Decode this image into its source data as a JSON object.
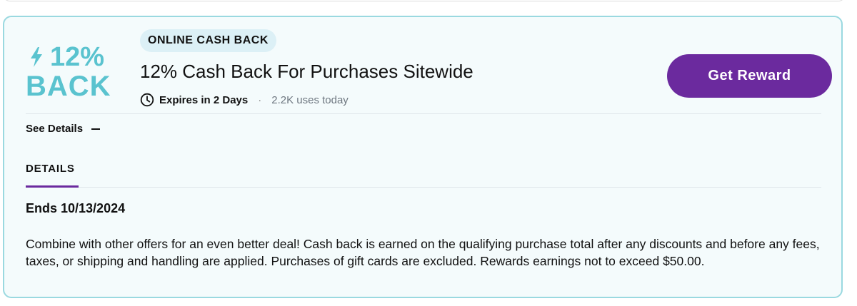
{
  "badge": {
    "line1": "12%",
    "line2": "BACK",
    "icon": "lightning-bolt-icon"
  },
  "offer": {
    "type_tag": "ONLINE CASH BACK",
    "title": "12% Cash Back For Purchases Sitewide",
    "expires": "Expires in 2 Days",
    "separator": "·",
    "uses": "2.2K uses today"
  },
  "actions": {
    "get_reward_label": "Get Reward"
  },
  "details_toggle": {
    "label": "See Details",
    "icon": "minus-icon"
  },
  "details": {
    "tab_label": "DETAILS",
    "ends": "Ends 10/13/2024",
    "body": "Combine with other offers for an even better deal! Cash back is earned on the qualifying purchase total after any discounts and before any fees, taxes, or shipping and handling are applied. Purchases of gift cards are excluded. Rewards earnings not to exceed $50.00."
  },
  "colors": {
    "accent": "#6b2a9e",
    "badge": "#5ac3cf",
    "card_bg": "#f4fbfc",
    "card_border": "#9ad9e0",
    "tag_bg": "#dcf0f6"
  }
}
